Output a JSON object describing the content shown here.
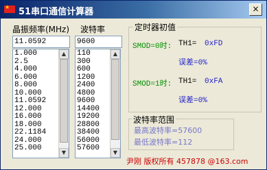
{
  "window": {
    "title": "51串口通信计算器",
    "close_label": "×"
  },
  "crystal": {
    "label": "晶振频率(MHz)",
    "value": "11.0592",
    "items": [
      "1.000",
      "2.5",
      "4.000",
      "6.000",
      "8.000",
      "10.000",
      "11.0592",
      "12.000",
      "16.000",
      "18.000",
      "22.1184",
      "24.000",
      "25.000"
    ]
  },
  "baud": {
    "label": "波特率",
    "value": "9600",
    "items": [
      "110",
      "300",
      "600",
      "1200",
      "2400",
      "4800",
      "9600",
      "14400",
      "19200",
      "28800",
      "38400",
      "56000",
      "57600"
    ]
  },
  "timer": {
    "title": "定时器初值",
    "smod0": {
      "label": "SMOD=0时:",
      "th_label": "TH1=",
      "th_value": "0xFD",
      "err_label": "误差=0%"
    },
    "smod1": {
      "label": "SMOD=1时:",
      "th_label": "TH1=",
      "th_value": "0xFA",
      "err_label": "误差=0%"
    }
  },
  "range": {
    "title": "波特率范围",
    "max": "最高波特率=57600",
    "min": "最低波特率=112"
  },
  "footer": "尹刚 版权所有 457878 @163.com"
}
